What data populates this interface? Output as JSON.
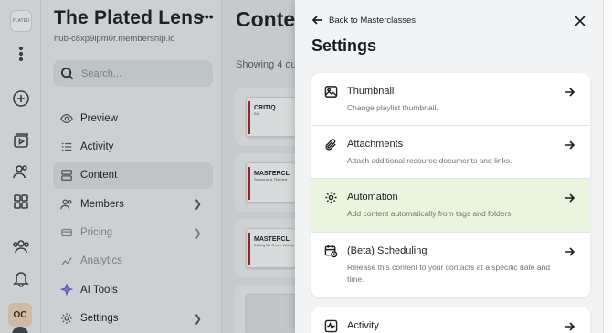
{
  "rail": {
    "logo_text": "PLATED",
    "avatar_initials": "OC"
  },
  "sidebar": {
    "title": "The Plated Lens",
    "more_icon": "more-horizontal-icon",
    "url": "hub-c8xp9lpm0r.membership.io",
    "search_placeholder": "Search...",
    "items": [
      {
        "label": "Preview",
        "icon": "eye-icon"
      },
      {
        "label": "Activity",
        "icon": "activity-list-icon"
      },
      {
        "label": "Content",
        "icon": "content-stack-icon",
        "active": true
      },
      {
        "label": "Members",
        "icon": "members-icon",
        "chevron": true
      },
      {
        "label": "Pricing",
        "icon": "pricing-icon",
        "chevron": true,
        "dim": true
      },
      {
        "label": "Analytics",
        "icon": "analytics-icon",
        "dim": true
      },
      {
        "label": "AI Tools",
        "icon": "sparkle-icon"
      },
      {
        "label": "Settings",
        "icon": "gear-icon",
        "chevron": true
      }
    ]
  },
  "content": {
    "heading": "Content",
    "showing_text": "Showing 4 ou",
    "cards": [
      {
        "thumb_title": "CRITIQ",
        "thumb_sub": "Ed"
      },
      {
        "thumb_title": "MASTERCL",
        "thumb_sub": "Seasonal & Themed"
      },
      {
        "thumb_title": "MASTERCL",
        "thumb_sub": "Editing Bo Crave-Worthy"
      }
    ]
  },
  "panel": {
    "back_label": "Back to Masterclasses",
    "title": "Settings",
    "rows": [
      {
        "title": "Thumbnail",
        "desc": "Change playlist thumbnail.",
        "icon": "image-icon"
      },
      {
        "title": "Attachments",
        "desc": "Attach additional resource documents and links.",
        "icon": "paperclip-icon"
      },
      {
        "title": "Automation",
        "desc": "Add content automatically from tags and folders.",
        "icon": "gear-icon",
        "highlight": true
      },
      {
        "title": "(Beta) Scheduling",
        "desc": "Release this content to your contacts at a specific date and time.",
        "icon": "calendar-clock-icon"
      }
    ],
    "activity_row": {
      "title": "Activity",
      "icon": "waveform-icon"
    }
  },
  "colors": {
    "highlight": "#e9f5dc",
    "sidebar_bg": "#f1f3f4",
    "active_nav": "#e1e4e6"
  }
}
